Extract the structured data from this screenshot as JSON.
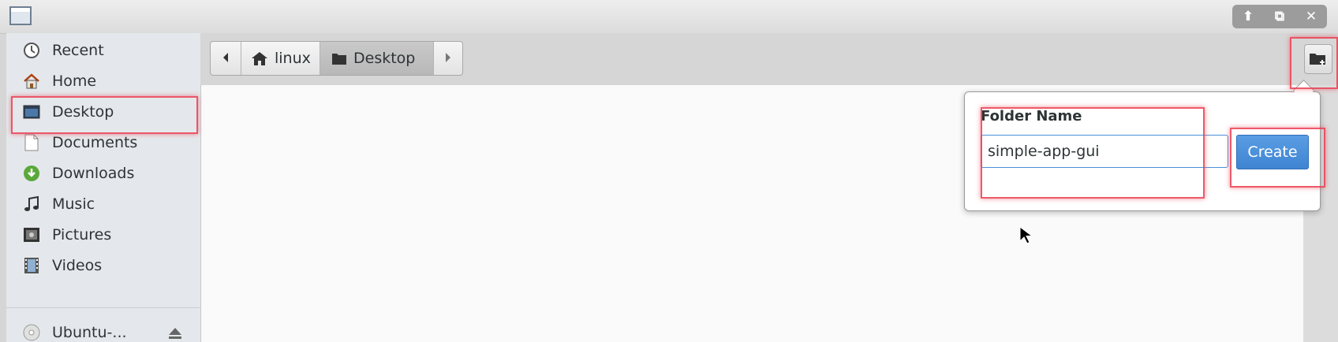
{
  "window": {
    "controls": {
      "up": "⬆",
      "restore": "⧉",
      "close": "✕"
    }
  },
  "sidebar": {
    "items": [
      {
        "label": "Recent",
        "icon": "recent-icon"
      },
      {
        "label": "Home",
        "icon": "home-icon"
      },
      {
        "label": "Desktop",
        "icon": "desktop-icon"
      },
      {
        "label": "Documents",
        "icon": "documents-icon"
      },
      {
        "label": "Downloads",
        "icon": "downloads-icon"
      },
      {
        "label": "Music",
        "icon": "music-icon"
      },
      {
        "label": "Pictures",
        "icon": "pictures-icon"
      },
      {
        "label": "Videos",
        "icon": "videos-icon"
      }
    ],
    "devices": [
      {
        "label": "Ubuntu-...",
        "icon": "disc-icon"
      }
    ]
  },
  "pathbar": {
    "segments": [
      {
        "label": "linux",
        "icon": "home-icon"
      },
      {
        "label": "Desktop",
        "icon": "folder-icon"
      }
    ]
  },
  "popover": {
    "title": "Folder Name",
    "input_value": "simple-app-gui",
    "create_label": "Create"
  },
  "colors": {
    "accent": "#4a90d9",
    "highlight": "#eb3c50"
  }
}
